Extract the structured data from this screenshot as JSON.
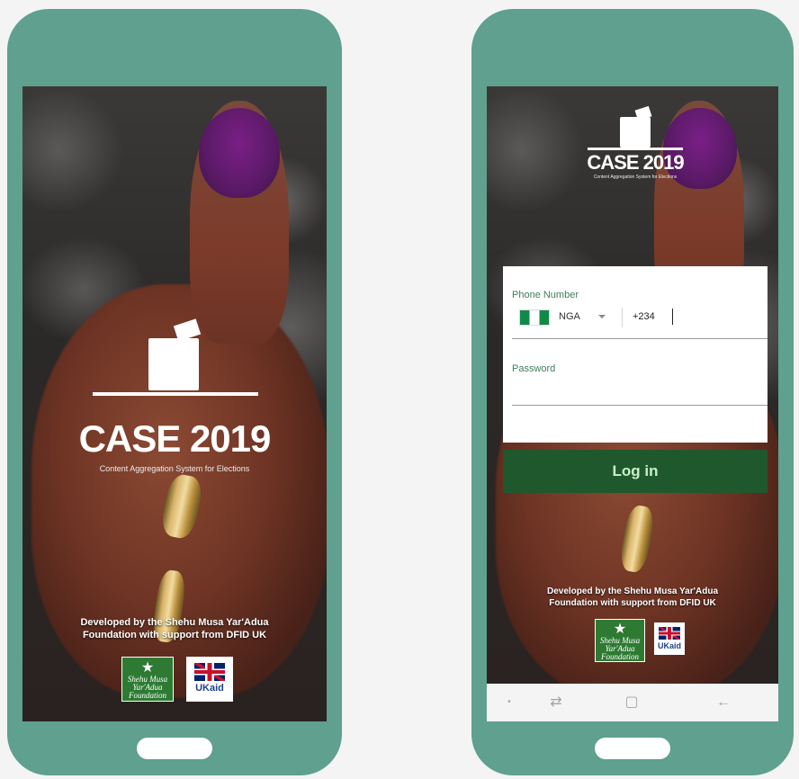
{
  "brand": {
    "title": "CASE 2019",
    "subtitle": "Content Aggregation System for Elections"
  },
  "credits": {
    "line1": "Developed by the Shehu Musa Yar'Adua",
    "line2": "Foundation with support from DFID UK"
  },
  "partners": {
    "smyf": {
      "line1": "Shehu Musa",
      "line2": "Yar'Adua",
      "line3": "Foundation"
    },
    "ukaid": "UKaid"
  },
  "login": {
    "phone_label": "Phone Number",
    "country_code": "NGA",
    "dial_code": "+234",
    "password_label": "Password",
    "login_label": "Log in"
  },
  "navbar": {
    "dot_icon": "•",
    "recents_icon": "⇄",
    "home_icon": "▢",
    "back_icon": "←"
  },
  "colors": {
    "phone_frame": "#5fa08e",
    "login_button": "#20582d",
    "login_text": "#c9f2c7",
    "label_green": "#3e7d5c",
    "nigeria_green": "#11894b",
    "ink_purple": "#5a1a66"
  }
}
